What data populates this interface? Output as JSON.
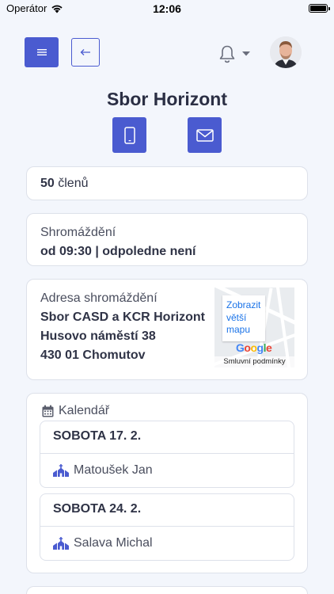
{
  "status_bar": {
    "carrier": "Operátor",
    "time": "12:06"
  },
  "header": {
    "menu_icon": "hamburger-icon",
    "back_icon": "arrow-left-icon",
    "notifications_icon": "bell-icon",
    "dropdown_icon": "caret-down-icon"
  },
  "page": {
    "title": "Sbor Horizont",
    "phone_icon": "phone-icon",
    "email_icon": "envelope-icon"
  },
  "members": {
    "count": "50",
    "label": "členů"
  },
  "meeting": {
    "label": "Shromáždění",
    "value": "od 09:30 | odpoledne není"
  },
  "address": {
    "label": "Adresa shromáždění",
    "name": "Sbor CASD a KCR Horizont",
    "street": "Husovo náměstí 38",
    "city": "430 01 Chomutov",
    "map_link": "Zobrazit větší mapu",
    "map_logo": "Google",
    "map_terms": "Smluvní podmínky"
  },
  "calendar": {
    "label": "Kalendář",
    "icon": "calendar-icon",
    "events": [
      {
        "date": "SOBOTA 17. 2.",
        "person": "Matoušek Jan",
        "icon": "church-icon"
      },
      {
        "date": "SOBOTA 24. 2.",
        "person": "Salava Michal",
        "icon": "church-icon"
      }
    ]
  },
  "colors": {
    "accent": "#4a5bd0",
    "background": "#f3f6fc",
    "card_border": "#dde1ea"
  }
}
